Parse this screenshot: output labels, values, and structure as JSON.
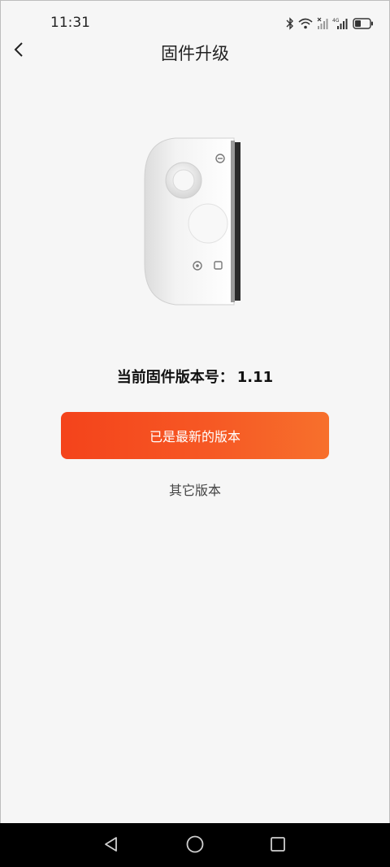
{
  "status_bar": {
    "time": "11:31",
    "icons": [
      "bluetooth-icon",
      "wifi-icon",
      "signal-1-icon",
      "signal-2-icon",
      "battery-icon"
    ],
    "network_label": "4G"
  },
  "header": {
    "title": "固件升级",
    "back_icon": "chevron-left-icon"
  },
  "firmware": {
    "label": "当前固件版本号：",
    "version": "1.11"
  },
  "primary_button": {
    "label": "已是最新的版本"
  },
  "secondary_link": {
    "label": "其它版本"
  },
  "colors": {
    "accent_start": "#f4431b",
    "accent_end": "#f7702c",
    "background": "#f6f6f6"
  },
  "nav_bar": {
    "icons": [
      "back-triangle-icon",
      "home-circle-icon",
      "recents-square-icon"
    ]
  }
}
